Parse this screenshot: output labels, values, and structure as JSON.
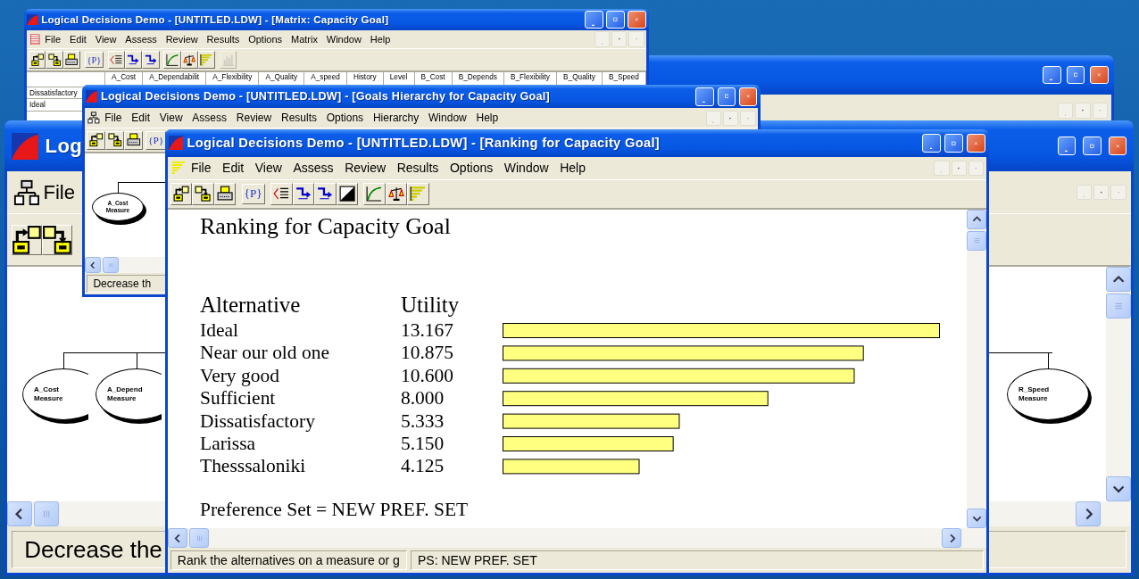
{
  "windows": [
    {
      "kind": "blank"
    },
    {
      "kind": "matrix",
      "title": "Logical Decisions Demo - [UNTITLED.LDW] - [Matrix: Capacity Goal]",
      "menu": [
        "File",
        "Edit",
        "View",
        "Assess",
        "Review",
        "Results",
        "Options",
        "Matrix",
        "Window",
        "Help"
      ],
      "toolbar": [
        [
          {
            "kind": "open",
            "disabled": false
          },
          {
            "kind": "save",
            "disabled": false
          },
          {
            "kind": "print",
            "disabled": false
          }
        ],
        [
          {
            "kind": "text",
            "label": "{P}",
            "disabled": false
          }
        ],
        [
          {
            "kind": "list",
            "disabled": false
          },
          {
            "kind": "arrows",
            "disabled": false
          },
          {
            "kind": "arrows",
            "disabled": false
          }
        ],
        [
          {
            "kind": "curve",
            "disabled": false
          },
          {
            "kind": "scale",
            "disabled": false
          },
          {
            "kind": "bars",
            "disabled": false
          }
        ],
        [
          {
            "kind": "columns",
            "disabled": true
          }
        ]
      ],
      "columns": [
        "A_Cost",
        "A_Dependabilit",
        "A_Flexibility",
        "A_Quality",
        "A_speed",
        "History",
        "Level",
        "B_Cost",
        "B_Depends",
        "B_Flexibility",
        "B_Quality",
        "B_Speed"
      ],
      "rows": [
        "Dissatisfactory",
        "Ideal"
      ]
    },
    {
      "kind": "hierarchy",
      "title": "Log",
      "menu": [
        "File"
      ],
      "toolbar": [
        [
          {
            "kind": "open"
          },
          {
            "kind": "save"
          }
        ]
      ],
      "nodes": [
        {
          "label": "A_Cost",
          "sub": "Measure"
        },
        {
          "label": "A_Depend",
          "sub": "Measure"
        }
      ],
      "right_nodes": [
        {
          "label": "R_Speed",
          "sub": "Measure"
        }
      ],
      "status": [
        "Decrease the"
      ]
    },
    {
      "kind": "hierarchy",
      "title": "Logical Decisions Demo - [UNTITLED.LDW] - [Goals Hierarchy for Capacity Goal]",
      "menu": [
        "File",
        "Edit",
        "View",
        "Assess",
        "Review",
        "Results",
        "Options",
        "Hierarchy",
        "Window",
        "Help"
      ],
      "toolbar": [
        [
          {
            "kind": "open"
          },
          {
            "kind": "save"
          },
          {
            "kind": "print"
          }
        ],
        [
          {
            "kind": "text",
            "label": "{P}"
          }
        ]
      ],
      "nodes": [
        {
          "label": "A_Cost",
          "sub": "Measure"
        }
      ],
      "status": [
        "Decrease th"
      ]
    },
    {
      "kind": "ranking",
      "title": "Logical Decisions Demo - [UNTITLED.LDW] - [Ranking for Capacity Goal]",
      "menu": [
        "File",
        "Edit",
        "View",
        "Assess",
        "Review",
        "Results",
        "Options",
        "Window",
        "Help"
      ],
      "toolbar": [
        [
          {
            "kind": "open"
          },
          {
            "kind": "save"
          },
          {
            "kind": "print"
          }
        ],
        [
          {
            "kind": "text",
            "label": "{P}"
          }
        ],
        [
          {
            "kind": "list"
          },
          {
            "kind": "arrows"
          },
          {
            "kind": "arrows"
          },
          {
            "kind": "contrast"
          }
        ],
        [
          {
            "kind": "curve"
          },
          {
            "kind": "scale"
          },
          {
            "kind": "bars"
          }
        ]
      ],
      "heading": "Ranking for Capacity Goal",
      "columns": [
        "Alternative",
        "Utility"
      ],
      "chart_data": {
        "type": "bar",
        "orientation": "horizontal",
        "categories": [
          "Ideal",
          "Near our old one",
          "Very good",
          "Sufficient",
          "Dissatisfactory",
          "Larissa",
          "Thesssaloniki"
        ],
        "values": [
          13.167,
          10.875,
          10.6,
          8,
          5.333,
          5.15,
          4.125
        ],
        "value_labels": [
          "13.167",
          "10.875",
          "10.600",
          "8.000",
          "5.333",
          "5.150",
          "4.125"
        ]
      },
      "footer": "Preference Set = NEW PREF. SET",
      "status": [
        "Rank the alternatives on a measure or g",
        "PS: NEW PREF. SET"
      ]
    }
  ]
}
